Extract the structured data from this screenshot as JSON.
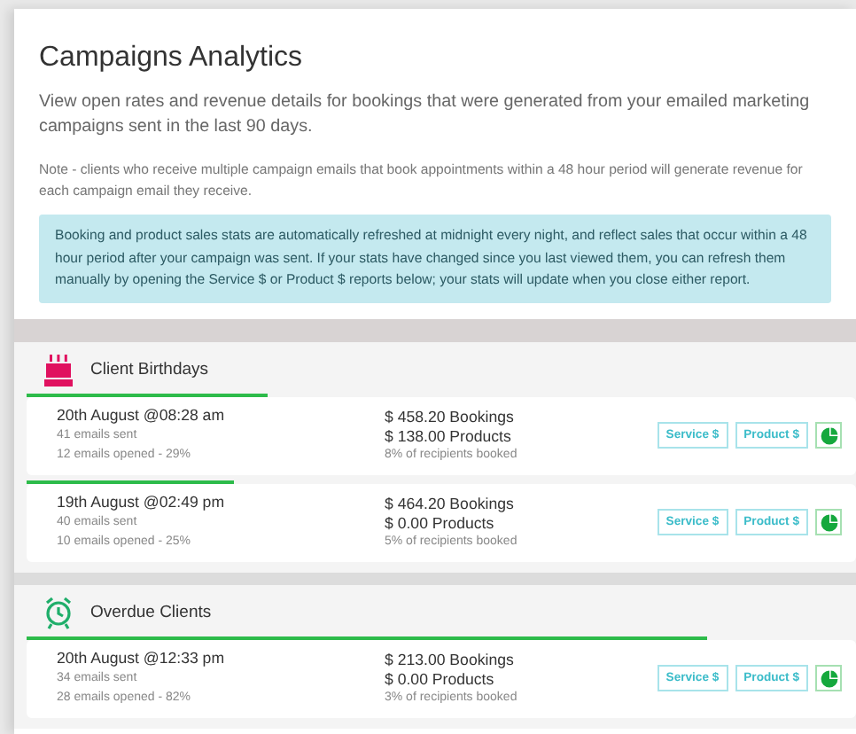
{
  "header": {
    "title": "Campaigns Analytics",
    "description": "View open rates and revenue details for bookings that were generated from your emailed marketing campaigns sent in the last 90 days.",
    "note": "Note - clients who receive multiple campaign emails that book appointments within a 48 hour period will generate revenue for each campaign email they receive.",
    "info": "Booking and product sales stats are automatically refreshed at midnight every night, and reflect sales that occur within a 48 hour period after your campaign was sent. If your stats have changed since you last viewed them, you can refresh them manually by opening the Service $ or Product $ reports below; your stats will update when you close either report."
  },
  "sections": [
    {
      "kind": "cake",
      "title": "Client Birthdays",
      "rows": [
        {
          "date": "20th August @08:28 am",
          "sent": "41 emails sent",
          "opened": "12 emails opened - 29%",
          "level": 0.29,
          "bookings": "$ 458.20 Bookings",
          "products": "$ 138.00 Products",
          "booked": "8% of recipients booked",
          "buttons": [
            "Service $",
            "Product $"
          ]
        },
        {
          "date": "19th August @02:49 pm",
          "sent": "40 emails sent",
          "opened": "10 emails opened - 25%",
          "level": 0.25,
          "bookings": "$ 464.20 Bookings",
          "products": "$ 0.00 Products",
          "booked": "5% of recipients booked",
          "buttons": [
            "Service $",
            "Product $"
          ]
        }
      ]
    },
    {
      "kind": "clock",
      "title": "Overdue Clients",
      "rows": [
        {
          "date": "20th August @12:33 pm",
          "sent": "34 emails sent",
          "opened": "28 emails opened - 82%",
          "level": 0.82,
          "bookings": "$ 213.00 Bookings",
          "products": "$ 0.00 Products",
          "booked": "3% of recipients booked",
          "buttons": [
            "Service $",
            "Product $"
          ]
        }
      ]
    }
  ]
}
